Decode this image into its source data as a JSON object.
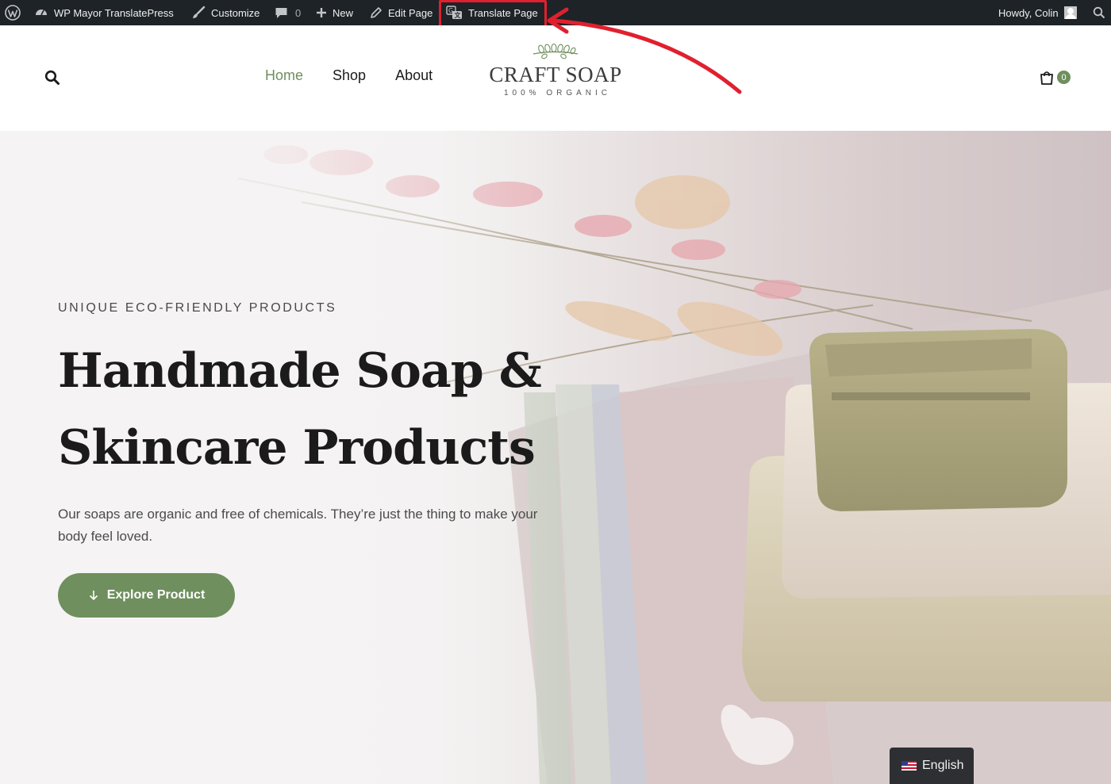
{
  "admin_bar": {
    "wp_logo_icon": "wordpress-logo-icon",
    "site_name": "WP Mayor TranslatePress",
    "customize": "Customize",
    "comments_count": "0",
    "new": "New",
    "edit_page": "Edit Page",
    "translate_page": "Translate Page",
    "howdy": "Howdy, Colin",
    "search_icon": "search-icon"
  },
  "annotation": {
    "color": "#e0202e",
    "target": "translate_page"
  },
  "header": {
    "nav": [
      "Home",
      "Shop",
      "About"
    ],
    "active_nav": "Home",
    "logo_title": "CRAFT SOAP",
    "logo_subtitle": "100% ORGANIC",
    "cart_count": "0"
  },
  "hero": {
    "eyebrow": "UNIQUE ECO-FRIENDLY PRODUCTS",
    "headline_line1": "Handmade Soap &",
    "headline_line2": "Skincare Products",
    "description": "Our soaps are organic and free of chemicals. They’re just the thing to make your body feel loved.",
    "cta": "Explore Product"
  },
  "language_switcher": {
    "label": "English",
    "flag_icon": "us-flag-icon"
  },
  "colors": {
    "accent_green": "#6f8f5e",
    "admin_bar_bg": "#1d2327",
    "highlight_red": "#e0202e"
  }
}
